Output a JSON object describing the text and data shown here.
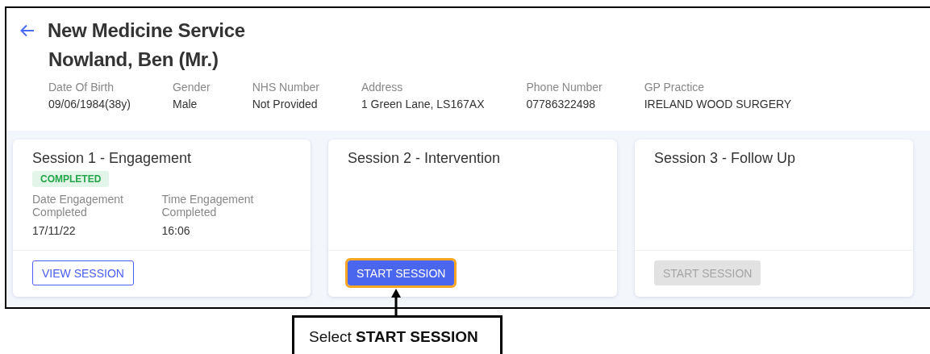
{
  "header": {
    "title": "New Medicine Service",
    "patient_name": "Nowland, Ben (Mr.)",
    "fields": [
      {
        "label": "Date Of Birth",
        "value": "09/06/1984(38y)"
      },
      {
        "label": "Gender",
        "value": "Male"
      },
      {
        "label": "NHS Number",
        "value": "Not Provided"
      },
      {
        "label": "Address",
        "value": "1 Green Lane, LS167AX"
      },
      {
        "label": "Phone Number",
        "value": "07786322498"
      },
      {
        "label": "GP Practice",
        "value": "IRELAND WOOD SURGERY"
      }
    ]
  },
  "sessions": [
    {
      "title": "Session 1 - Engagement",
      "status": "COMPLETED",
      "fields": [
        {
          "label": "Date Engagement Completed",
          "value": "17/11/22"
        },
        {
          "label": "Time Engagement Completed",
          "value": "16:06"
        }
      ],
      "button": {
        "label": "VIEW SESSION",
        "kind": "outline",
        "disabled": false,
        "highlighted": false
      }
    },
    {
      "title": "Session 2 - Intervention",
      "button": {
        "label": "START SESSION",
        "kind": "filled",
        "disabled": false,
        "highlighted": true
      }
    },
    {
      "title": "Session 3 - Follow Up",
      "button": {
        "label": "START SESSION",
        "kind": "filled",
        "disabled": true,
        "highlighted": false
      }
    }
  ],
  "callout": {
    "text": "Select **START SESSION**"
  }
}
